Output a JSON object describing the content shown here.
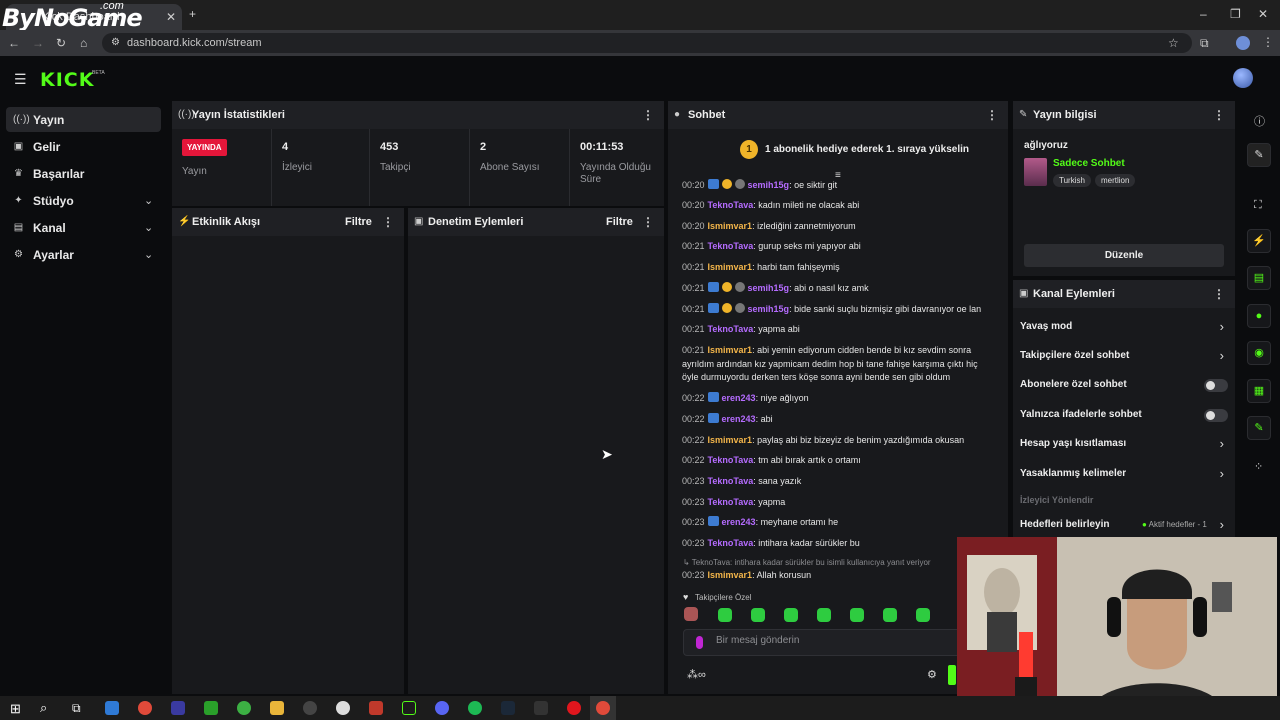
{
  "browser": {
    "watermark": "ByNoGame",
    "watermark_sub": ".com",
    "tab_title": "Kick Dashboard",
    "url": "dashboard.kick.com/stream"
  },
  "app": {
    "logo": "KICK",
    "logo_beta": "BETA"
  },
  "sidebar": {
    "items": [
      {
        "label": "Yayın",
        "icon": "broadcast-icon"
      },
      {
        "label": "Gelir",
        "icon": "revenue-icon"
      },
      {
        "label": "Başarılar",
        "icon": "trophy-icon"
      },
      {
        "label": "Stüdyo",
        "icon": "studio-icon"
      },
      {
        "label": "Kanal",
        "icon": "channel-icon"
      },
      {
        "label": "Ayarlar",
        "icon": "gear-icon"
      }
    ]
  },
  "stats": {
    "title": "Yayın İstatistikleri",
    "live_badge": "YAYINDA",
    "live_label": "Yayın",
    "viewers_value": "4",
    "viewers_label": "İzleyici",
    "followers_value": "453",
    "followers_label": "Takipçi",
    "subs_value": "2",
    "subs_label": "Abone Sayısı",
    "uptime_value": "00:11:53",
    "uptime_label": "Yayında Olduğu Süre"
  },
  "activity": {
    "title": "Etkinlik Akışı",
    "filter": "Filtre"
  },
  "moderation": {
    "title": "Denetim Eylemleri",
    "filter": "Filtre"
  },
  "chat": {
    "title": "Sohbet",
    "banner_count": "1",
    "banner_text": "1 abonelik hediye ederek 1. sıraya yükselin",
    "user_colors": {
      "semih15g": "#b56cff",
      "TeknoTava": "#b56cff",
      "Ismimvar1": "#f3b54a",
      "eren243": "#b56cff"
    },
    "messages": [
      {
        "time": "00:20",
        "user": "semih15g",
        "text": ": oe siktir git",
        "badges": [
          "b",
          "y",
          "g"
        ]
      },
      {
        "time": "00:20",
        "user": "TeknoTava",
        "text": ": kadın mileti ne olacak abi",
        "badges": []
      },
      {
        "time": "00:20",
        "user": "Ismimvar1",
        "text": ": izlediğini zannetmiyorum",
        "badges": []
      },
      {
        "time": "00:21",
        "user": "TeknoTava",
        "text": ": gurup seks mi yapıyor abi",
        "badges": []
      },
      {
        "time": "00:21",
        "user": "Ismimvar1",
        "text": ": harbi tam fahişeymiş",
        "badges": []
      },
      {
        "time": "00:21",
        "user": "semih15g",
        "text": ": abi o nasıl kız amk",
        "badges": [
          "b",
          "y",
          "g"
        ]
      },
      {
        "time": "00:21",
        "user": "semih15g",
        "text": ": bide sanki suçlu bizmişiz gibi davranıyor oe lan",
        "badges": [
          "b",
          "y",
          "g"
        ]
      },
      {
        "time": "00:21",
        "user": "TeknoTava",
        "text": ": yapma abi",
        "badges": []
      },
      {
        "time": "00:21",
        "user": "Ismimvar1",
        "text": ": abi yemin ediyorum cidden bende bi kız sevdim sonra ayrıldım ardından kız yapmicam dedim hop bi tane fahişe karşıma çıktı hiç öyle durmuyordu derken ters köşe sonra ayni bende sen gibi oldum",
        "badges": []
      },
      {
        "time": "00:22",
        "user": "eren243",
        "text": ": niye ağlıyon",
        "badges": [
          "b"
        ]
      },
      {
        "time": "00:22",
        "user": "eren243",
        "text": ": abi",
        "badges": [
          "b"
        ]
      },
      {
        "time": "00:22",
        "user": "Ismimvar1",
        "text": ": paylaş abi biz bizeyiz de benim yazdığımıda okusan",
        "badges": []
      },
      {
        "time": "00:22",
        "user": "TeknoTava",
        "text": ": tm abi bırak artık o ortamı",
        "badges": []
      },
      {
        "time": "00:23",
        "user": "TeknoTava",
        "text": ": sana yazık",
        "badges": []
      },
      {
        "time": "00:23",
        "user": "TeknoTava",
        "text": ": yapma",
        "badges": []
      },
      {
        "time": "00:23",
        "user": "eren243",
        "text": ": meyhane ortamı he",
        "badges": [
          "b"
        ]
      },
      {
        "time": "00:23",
        "user": "TeknoTava",
        "text": ": intihara kadar sürükler bu",
        "badges": []
      },
      {
        "time": "00:23",
        "user": "Ismimvar1",
        "text": ": Allah korusun",
        "badges": []
      }
    ],
    "reply_preview": "TeknoTava: intihara kadar sürükler bu isimli kullanıcıya yanıt veriyor",
    "emote_label": "Takipçilere Özel",
    "input_placeholder": "Bir mesaj gönderin"
  },
  "stream_info": {
    "title": "Yayın bilgisi",
    "stream_title": "ağlıyoruz",
    "category": "Sadece Sohbet",
    "tags": [
      "Turkish",
      "mertlion"
    ],
    "edit_button": "Düzenle"
  },
  "channel_actions": {
    "title": "Kanal Eylemleri",
    "items": [
      {
        "label": "Yavaş mod",
        "control": "chevron"
      },
      {
        "label": "Takipçilere özel sohbet",
        "control": "chevron"
      },
      {
        "label": "Abonelere özel sohbet",
        "control": "toggle"
      },
      {
        "label": "Yalnızca ifadelerle sohbet",
        "control": "toggle"
      },
      {
        "label": "Hesap yaşı kısıtlaması",
        "control": "chevron"
      },
      {
        "label": "Yasaklanmış kelimeler",
        "control": "chevron"
      }
    ],
    "section_label": "İzleyici Yönlendir",
    "goals_label": "Hedefleri belirleyin",
    "goals_status": "Aktif hedefler - 1"
  },
  "colors": {
    "accent": "#53fc18",
    "live": "#e4163a",
    "panel": "#18191c"
  }
}
